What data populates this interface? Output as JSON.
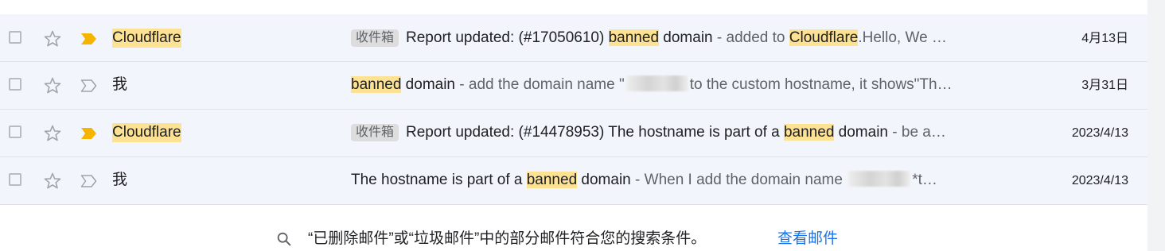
{
  "emails": [
    {
      "sender": "Cloudflare",
      "sender_highlighted": true,
      "important": true,
      "label": "收件箱",
      "subject_parts": [
        {
          "text": "Report updated: (#17050610) ",
          "hl": false
        },
        {
          "text": "banned",
          "hl": true
        },
        {
          "text": " domain",
          "hl": false
        }
      ],
      "snippet_parts": [
        {
          "text": " - added to ",
          "hl": false
        },
        {
          "text": "Cloudflare",
          "hl": true
        },
        {
          "text": ".Hello, We …",
          "hl": false
        }
      ],
      "date": "4月13日"
    },
    {
      "sender": "我",
      "sender_highlighted": false,
      "important": false,
      "label": "",
      "subject_parts": [
        {
          "text": "banned",
          "hl": true
        },
        {
          "text": " domain",
          "hl": false
        }
      ],
      "snippet_parts": [
        {
          "text": " - add the domain name \"",
          "hl": false
        },
        {
          "redacted": true
        },
        {
          "text": "to the custom hostname, it shows\"Th…",
          "hl": false
        }
      ],
      "date": "3月31日"
    },
    {
      "sender": "Cloudflare",
      "sender_highlighted": true,
      "important": true,
      "label": "收件箱",
      "subject_parts": [
        {
          "text": "Report updated: (#14478953) The hostname is part of a ",
          "hl": false
        },
        {
          "text": "banned",
          "hl": true
        },
        {
          "text": " domain",
          "hl": false
        }
      ],
      "snippet_parts": [
        {
          "text": " - be a…",
          "hl": false
        }
      ],
      "date": "2023/4/13"
    },
    {
      "sender": "我",
      "sender_highlighted": false,
      "important": false,
      "label": "",
      "subject_parts": [
        {
          "text": "The hostname is part of a ",
          "hl": false
        },
        {
          "text": "banned",
          "hl": true
        },
        {
          "text": " domain",
          "hl": false
        }
      ],
      "snippet_parts": [
        {
          "text": " - When I add the domain name ",
          "hl": false
        },
        {
          "redacted": true
        },
        {
          "text": "*t…",
          "hl": false
        }
      ],
      "date": "2023/4/13"
    }
  ],
  "footer": {
    "notice": "“已删除邮件”或“垃圾邮件”中的部分邮件符合您的搜索条件。",
    "link": "查看邮件"
  },
  "colors": {
    "row_bg": "#f2f6fc",
    "highlight": "#fde293",
    "important_marker": "#f4b400",
    "link": "#1a73e8"
  },
  "icons": {
    "checkbox": "checkbox-icon",
    "star": "star-outline-icon",
    "important": "importance-marker-icon",
    "search": "search-icon"
  }
}
